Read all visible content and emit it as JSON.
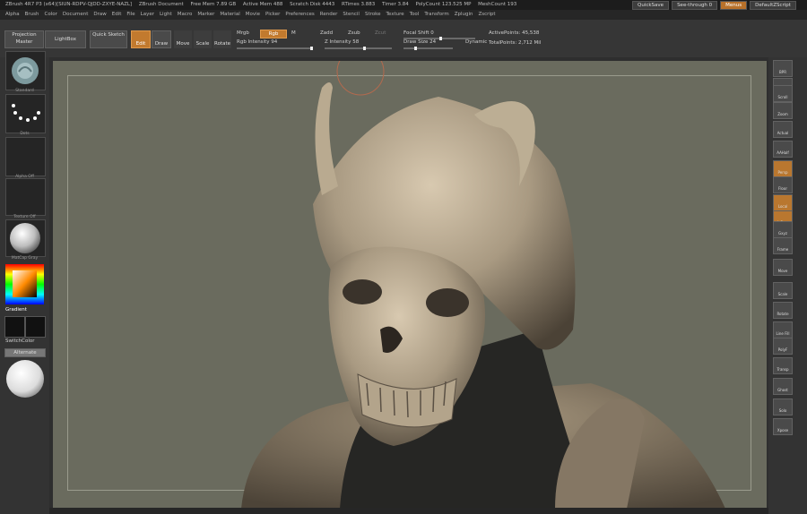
{
  "title": {
    "app": "ZBrush 4R7 P3 (x64)[SIUN-RDPV-QJDD-ZXYE-NAZL]",
    "document": "ZBrush Document",
    "free_mem": "Free Mem 7.89 GB",
    "active_mem": "Active Mem 488",
    "scratch_disk": "Scratch Disk 4443",
    "rtimes": "RTimes 3.883",
    "timer": "Timer 3.84",
    "poly_count": "PolyCount 123.525 MP",
    "mesh_count": "MeshCount 193",
    "quicksave": "QuickSave",
    "see_through": "See-through 0",
    "menus": "Menus",
    "default_script": "DefaultZScript"
  },
  "menu": [
    "Alpha",
    "Brush",
    "Color",
    "Document",
    "Draw",
    "Edit",
    "File",
    "Layer",
    "Light",
    "Macro",
    "Marker",
    "Material",
    "Movie",
    "Picker",
    "Preferences",
    "Render",
    "Stencil",
    "Stroke",
    "Texture",
    "Tool",
    "Transform",
    "Zplugin",
    "Zscript"
  ],
  "toolbar": {
    "projection_master": "Projection Master",
    "lightbox": "LightBox",
    "quick_sketch": "Quick Sketch",
    "edit": "Edit",
    "draw": "Draw",
    "move": "Move",
    "scale": "Scale",
    "rotate": "Rotate",
    "mrgb": "Mrgb",
    "rgb": "Rgb",
    "m": "M",
    "zadd": "Zadd",
    "zsub": "Zsub",
    "zcut": "Zcut",
    "rgb_intensity": "Rgb Intensity 94",
    "z_intensity": "Z Intensity 58",
    "focal_shift": "Focal Shift 0",
    "draw_size": "Draw Size 24",
    "dynamic": "Dynamic",
    "active_points": "ActivePoints: 45,538",
    "total_points": "TotalPoints: 2,712 Mil"
  },
  "left_shelf": {
    "brush_caption": "Standard",
    "stroke_caption": "Dots",
    "alpha_caption": "Alpha Off",
    "texture_caption": "Texture Off",
    "material_caption": "MatCap Gray",
    "gradient": "Gradient",
    "switch_color": "SwitchColor",
    "alternate": "Alternate"
  },
  "right_shelf": [
    "BPR",
    "SPix 3",
    "Scroll",
    "Zoom",
    "Actual",
    "AAHalf",
    "Persp",
    "Floor",
    "Local",
    "L.Sym",
    "Gxyz",
    "Frame",
    "Move",
    "Scale",
    "Rotate",
    "Line Fill",
    "PolyF",
    "Transp",
    "Ghost",
    "Solo",
    "Xpose"
  ],
  "colors": {
    "accent": "#c27a2e",
    "canvas_bg": "#6a6b5e",
    "ui_bg": "#363636"
  }
}
